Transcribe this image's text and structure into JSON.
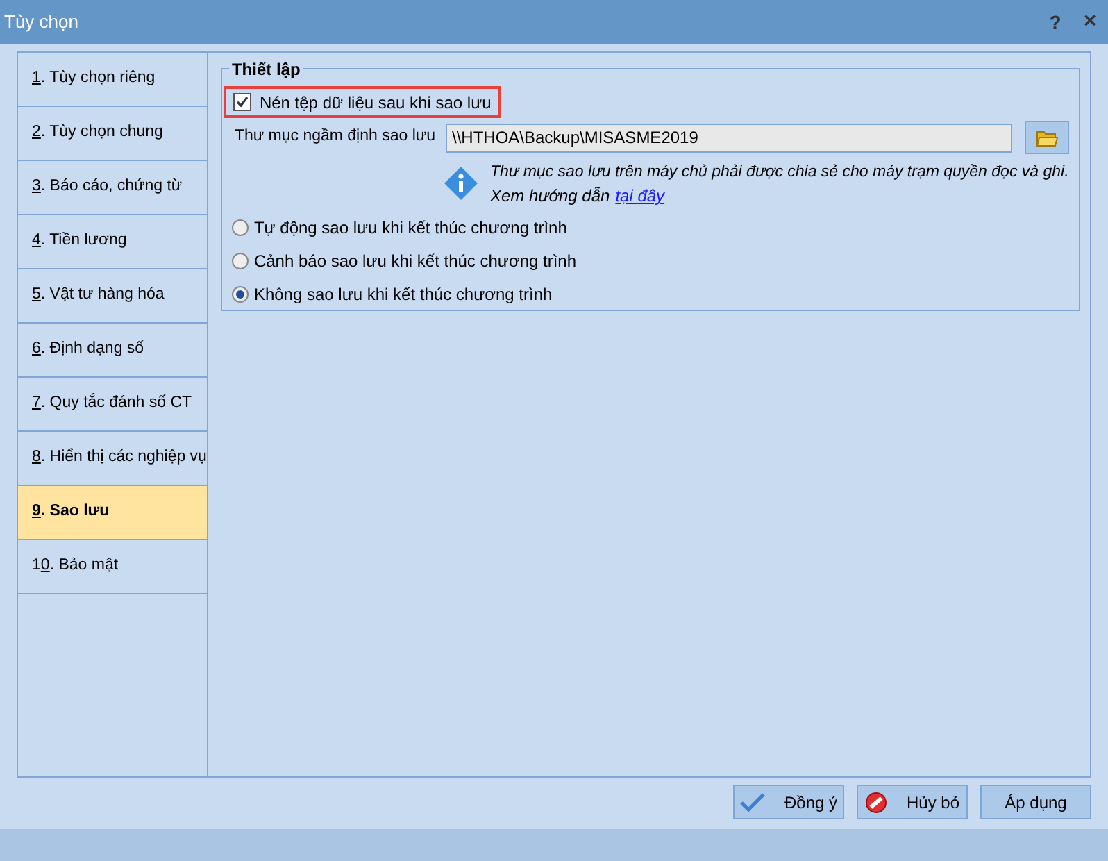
{
  "window": {
    "title": "Tùy chọn",
    "help": "?",
    "close": "×"
  },
  "sidebar": {
    "items": [
      {
        "key": "1",
        "after": ". Tùy chọn riêng",
        "selected": false
      },
      {
        "key": "2",
        "after": ". Tùy chọn chung",
        "selected": false
      },
      {
        "key": "3",
        "after": ". Báo cáo, chứng từ",
        "selected": false
      },
      {
        "key": "4",
        "after": ". Tiền lương",
        "selected": false
      },
      {
        "key": "5",
        "after": ". Vật tư hàng hóa",
        "selected": false
      },
      {
        "key": "6",
        "after": ". Định dạng số",
        "selected": false
      },
      {
        "key": "7",
        "after": ". Quy tắc đánh số CT",
        "selected": false
      },
      {
        "key": "8",
        "after": ". Hiển thị các nghiệp vụ",
        "selected": false
      },
      {
        "key": "9",
        "after": ". Sao lưu",
        "selected": true
      },
      {
        "before": "1",
        "key": "0",
        "after": ". Bảo mật",
        "selected": false
      }
    ]
  },
  "settings": {
    "legend": "Thiết lập",
    "compress": {
      "label": "Nén tệp dữ liệu sau khi sao lưu",
      "checked": true
    },
    "folder": {
      "label": "Thư mục ngầm định sao lưu",
      "value": "\\\\HTHOA\\Backup\\MISASME2019"
    },
    "note": {
      "text": "Thư mục sao lưu trên máy chủ phải được chia sẻ cho máy trạm quyền đọc và ghi.",
      "guide": "Xem hướng dẫn",
      "link": "tại đây"
    },
    "options": [
      {
        "label": "Tự động sao lưu khi kết thúc chương trình",
        "selected": false
      },
      {
        "label": "Cảnh báo sao lưu khi kết thúc chương trình",
        "selected": false
      },
      {
        "label": "Không sao lưu khi kết thúc chương trình",
        "selected": true
      }
    ]
  },
  "buttons": [
    {
      "kind": "ok",
      "label": "Đồng ý"
    },
    {
      "kind": "cancel",
      "label": "Hủy bỏ"
    },
    {
      "kind": "apply",
      "label": "Áp dụng"
    }
  ]
}
